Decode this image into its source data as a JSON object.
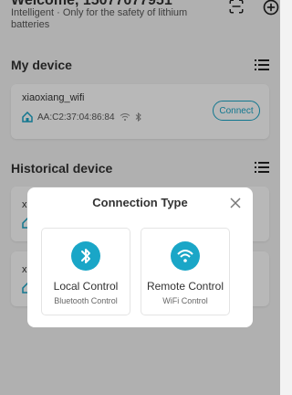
{
  "header": {
    "welcome": "Welcome,  15077077951",
    "subtitle": "Intelligent · Only for the safety of lithium batteries"
  },
  "icons": {
    "scan": "scan-icon",
    "add": "add-circle-icon",
    "list": "list-icon",
    "home": "home-icon",
    "wifi": "wifi-icon",
    "bluetooth": "bluetooth-icon",
    "close": "close-icon"
  },
  "my_device": {
    "title": "My device",
    "device": {
      "name": "xiaoxiang_wifi",
      "mac": "AA:C2:37:04:86:84",
      "connect_label": "Connect"
    }
  },
  "historical_device": {
    "title": "Historical device",
    "items": [
      {
        "name": "x"
      },
      {
        "name": "x"
      }
    ]
  },
  "modal": {
    "title": "Connection Type",
    "local": {
      "label": "Local Control",
      "sub": "Bluetooth Control"
    },
    "remote": {
      "label": "Remote Control",
      "sub": "WiFi Control"
    }
  },
  "colors": {
    "accent": "#1aa6c7",
    "overlay": "rgba(0,0,0,0.28)"
  }
}
